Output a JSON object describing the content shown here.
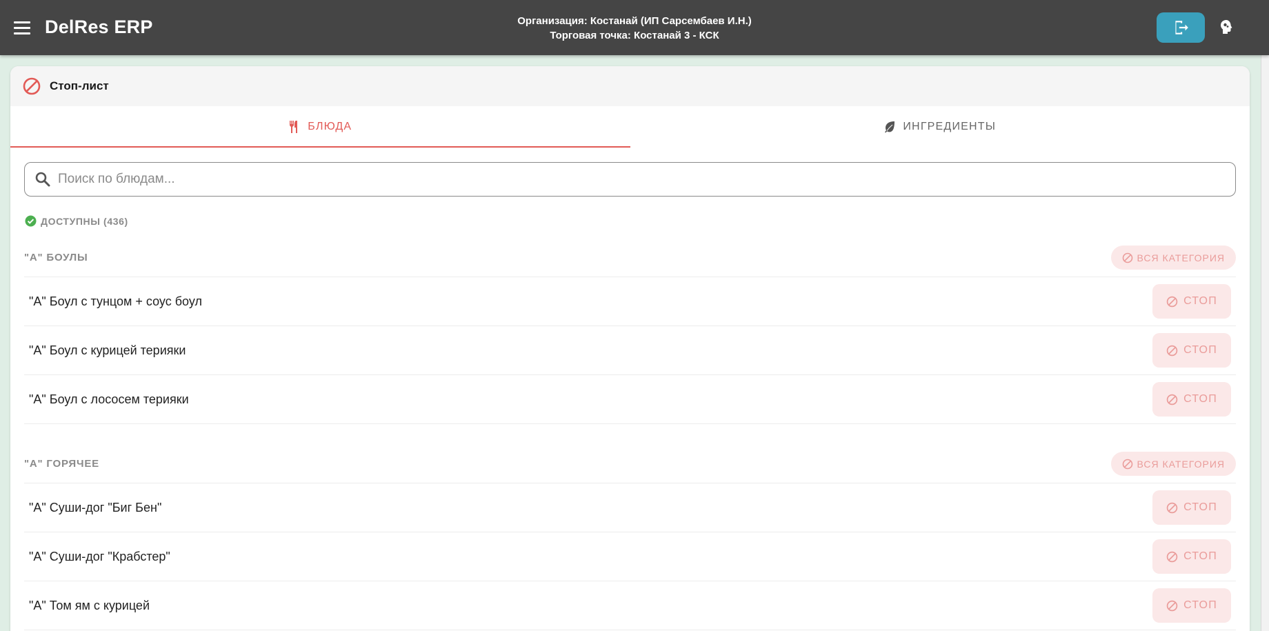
{
  "appbar": {
    "title": "DelRes ERP",
    "org_line": "Организация: Костанай (ИП Сарсембаев И.Н.)",
    "point_line": "Торговая точка: Костанай 3 - КСК",
    "icons": [
      "menu-icon",
      "logout-icon",
      "brain-theme-icon"
    ]
  },
  "card": {
    "title": "Стоп-лист",
    "icon": "block-icon"
  },
  "tabs": [
    {
      "label": "БЛЮДА",
      "icon": "fork-knife-icon",
      "active": true
    },
    {
      "label": "ИНГРЕДИЕНТЫ",
      "icon": "leaf-icon",
      "active": false
    }
  ],
  "search": {
    "placeholder": "Поиск по блюдам...",
    "value": ""
  },
  "available": {
    "label": "ДОСТУПНЫ (436)"
  },
  "categories": [
    {
      "name": "\"А\" БОУЛЫ",
      "stop_all_label": "ВСЯ КАТЕГОРИЯ",
      "items": [
        {
          "name": "\"А\" Боул с тунцом + соус боул",
          "stop_label": "СТОП"
        },
        {
          "name": "\"А\" Боул с курицей терияки",
          "stop_label": "СТОП"
        },
        {
          "name": "\"А\" Боул с лососем терияки",
          "stop_label": "СТОП"
        }
      ]
    },
    {
      "name": "\"А\" ГОРЯЧЕЕ",
      "stop_all_label": "ВСЯ КАТЕГОРИЯ",
      "items": [
        {
          "name": "\"А\" Суши-дог \"Биг Бен\"",
          "stop_label": "СТОП"
        },
        {
          "name": "\"А\" Суши-дог \"Крабстер\"",
          "stop_label": "СТОП"
        },
        {
          "name": "\"А\" Том ям с курицей",
          "stop_label": "СТОП"
        }
      ]
    }
  ],
  "colors": {
    "appbar": "#454545",
    "accent": "#e25a56",
    "logout": "#3aa0bc",
    "stop_bg": "#fbe8e8",
    "stop_text": "#ea9c9a",
    "available": "#4caf50"
  }
}
